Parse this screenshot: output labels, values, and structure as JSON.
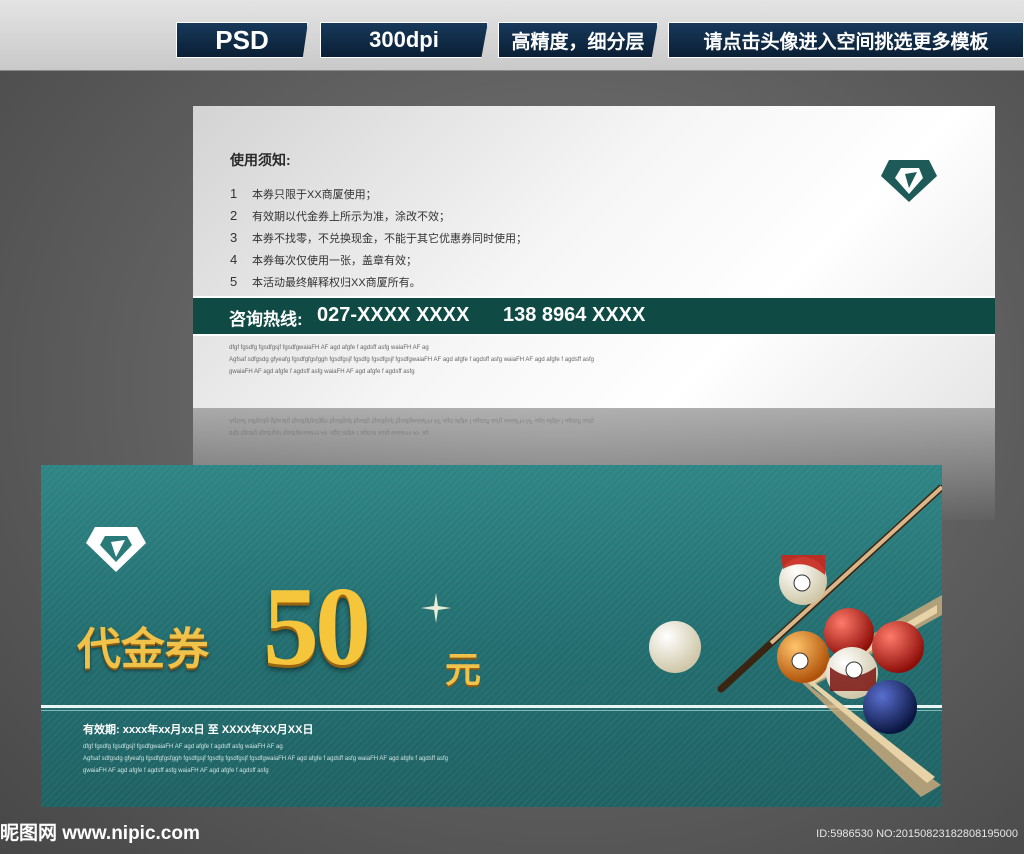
{
  "header": {
    "tabs": [
      "PSD",
      "300dpi",
      "高精度，细分层",
      "请点击头像进入空间挑选更多模板"
    ]
  },
  "back_card": {
    "notes_title": "使用须知:",
    "rules": [
      {
        "num": "1",
        "text": "本券只限于XX商厦使用；"
      },
      {
        "num": "2",
        "text": "有效期以代金券上所示为准，涂改不效；"
      },
      {
        "num": "3",
        "text": "本券不找零，不兑换现金，不能于其它优惠券同时使用；"
      },
      {
        "num": "4",
        "text": "本券每次仅使用一张，盖章有效；"
      },
      {
        "num": "5",
        "text": "本活动最终解释权归XX商厦所有。"
      }
    ],
    "hotline_label": "咨询热线:",
    "hotline_number_1": "027-XXXX XXXX",
    "hotline_number_2": "138 8964 XXXX",
    "fine_print": [
      "dfgf fgsdfg  fgsdfgsjf fgsdfgwaiaFH AF agd afgfe f agdsff   asfg   waiaFH AF ag",
      "Agfsaf sdfgsdg gfyeafg fgsdfgfgsfggh fgsdfgsjf fgsdfg   fgsdfgsjf fgsdfgwaiaFH AF agd afgfe f agdsff   asfg   waiaFH AF agd afgfe f agdsff   asfg",
      "gwaiaFH AF agd afgfe f agdsff   asfg   waiaFH AF agd afgfe f agdsff   asfg"
    ]
  },
  "front_card": {
    "voucher_label": "代金券",
    "amount": "50",
    "unit": "元",
    "validity": "有效期:  xxxx年xx月xx日    至    XXXX年XX月XX日",
    "fine_print": [
      "dfgf fgsdfg  fgsdfgsjf fgsdfgwaiaFH AF agd afgfe f agdsff   asfg   waiaFH AF ag",
      "Agfsaf sdfgsdg gfyeafg fgsdfgfgsfggh fgsdfgsjf fgsdfg   fgsdfgsjf fgsdfgwaiaFH AF agd afgfe f agdsff   asfg   waiaFH AF agd afgfe f agdsff   asfg",
      "gwaiaFH AF agd afgfe f agdsff   asfg   waiaFH AF agd afgfe f agdsff   asfg"
    ]
  },
  "footer": {
    "watermark": "昵图网 www.nipic.com",
    "image_id": "ID:5986530 NO:20150823182808195000"
  },
  "colors": {
    "hotline_bar": "#0f4a45",
    "front_teal": "#236e70",
    "gold": "#f1c24a",
    "tab_navy": "#0a1e33"
  }
}
